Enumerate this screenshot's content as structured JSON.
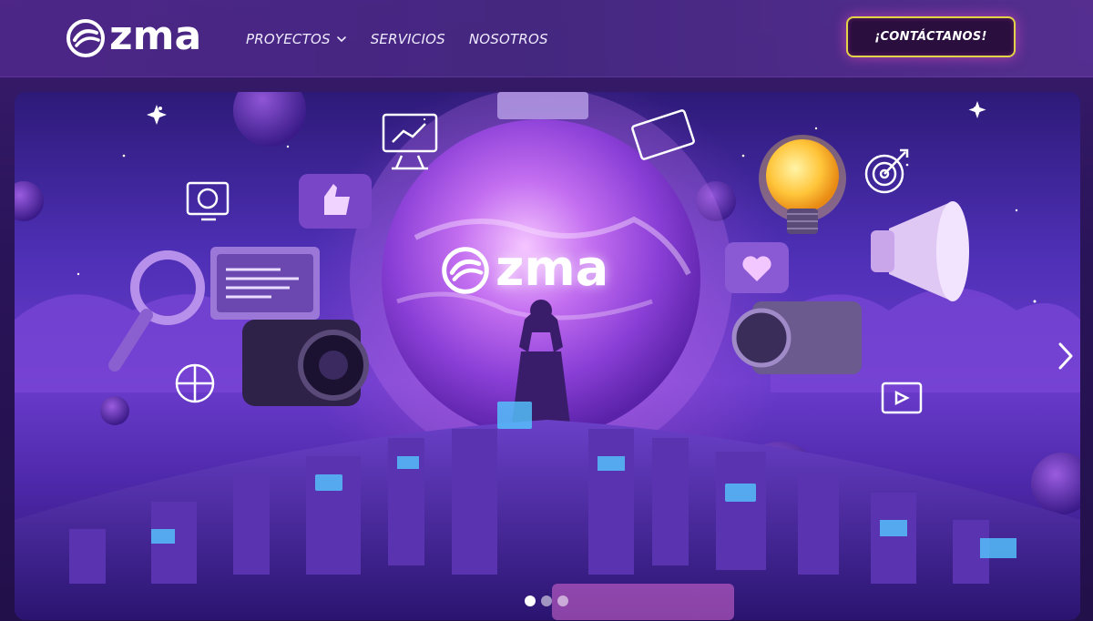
{
  "header": {
    "logo_text": "zma",
    "nav": [
      {
        "label": "PROYECTOS",
        "has_dropdown": true
      },
      {
        "label": "SERVICIOS",
        "has_dropdown": false
      },
      {
        "label": "NOSOTROS",
        "has_dropdown": false
      }
    ],
    "cta_label": "¡CONTÁCTANOS!"
  },
  "hero": {
    "logo_text": "zma",
    "carousel": {
      "slide_count": 3,
      "active_index": 0,
      "next_icon": "chevron-right-icon"
    }
  },
  "colors": {
    "brand_purple": "#5a32b8",
    "cta_border": "#e1d446",
    "cta_bg": "#2a0e3e",
    "glow_pink": "#ff50c8"
  }
}
